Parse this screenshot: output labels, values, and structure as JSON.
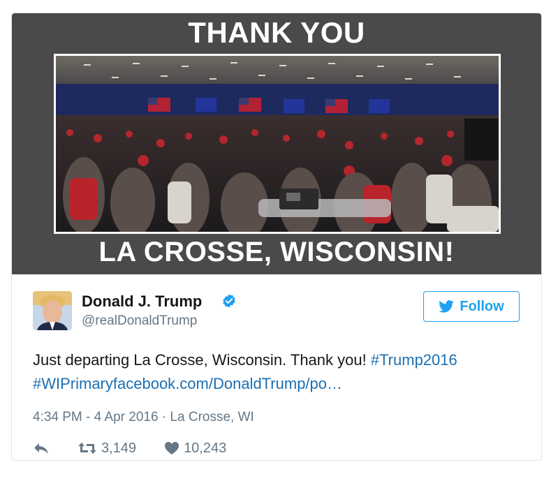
{
  "media": {
    "caption_top": "THANK YOU",
    "caption_bottom": "LA CROSSE, WISCONSIN!"
  },
  "author": {
    "name": "Donald J. Trump",
    "handle": "@realDonaldTrump",
    "verified": true
  },
  "follow_button": {
    "label": "Follow"
  },
  "tweet": {
    "text": "Just departing La Crosse, Wisconsin. Thank you! ",
    "hashtag1": "#Trump2016",
    "hashtag2_and_link": "#WIPrimaryfacebook.com/DonaldTrump/po…"
  },
  "meta": {
    "timestamp": "4:34 PM - 4 Apr 2016",
    "separator": " · ",
    "location": "La Crosse, WI"
  },
  "actions": {
    "reply_icon": "reply-arrow-icon",
    "retweet_icon": "retweet-icon",
    "retweet_count": "3,149",
    "like_icon": "heart-icon",
    "like_count": "10,243"
  },
  "colors": {
    "link": "#1b6fb3",
    "follow": "#1da1f2",
    "muted": "#657786",
    "media_bg": "#4a4a4a"
  }
}
